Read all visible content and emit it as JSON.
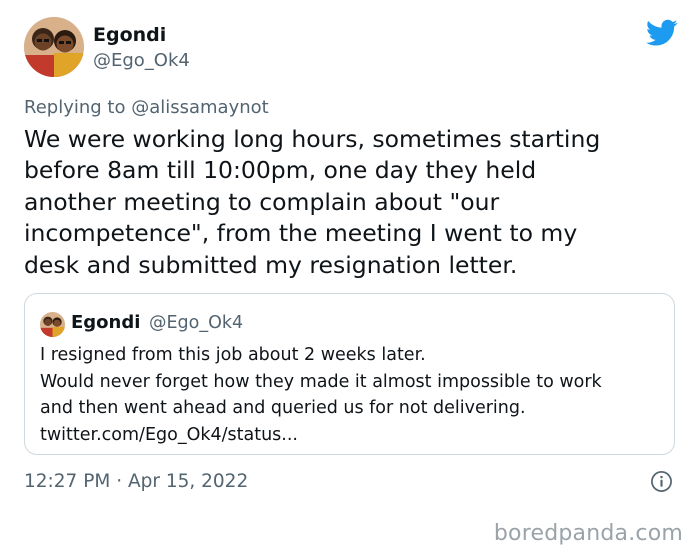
{
  "author": {
    "name": "Egondi",
    "handle": "@Ego_Ok4",
    "avatar": "avatar-photo-two-people"
  },
  "reply": {
    "label": "Replying to @alissamaynot"
  },
  "tweet": {
    "text": "We were working long hours, sometimes starting\nbefore 8am till 10:00pm, one day they held\nanother meeting to complain about \"our\nincompetence\", from the meeting I went to my\ndesk and submitted my resignation letter."
  },
  "quote": {
    "name": "Egondi",
    "handle": "@Ego_Ok4",
    "text": "I resigned from this job about 2 weeks later.\nWould never forget how they made it almost impossible to work\nand then went ahead and queried us for not delivering.\ntwitter.com/Ego_Ok4/status..."
  },
  "meta": {
    "timestamp": "12:27 PM · Apr 15, 2022"
  },
  "icons": {
    "platform": "twitter-bird-icon",
    "info": "info-icon"
  },
  "colors": {
    "brand_blue": "#1d9bf0",
    "secondary_text": "#536471",
    "border": "#cfd9de"
  },
  "watermark": {
    "text": "boredpanda.com"
  }
}
